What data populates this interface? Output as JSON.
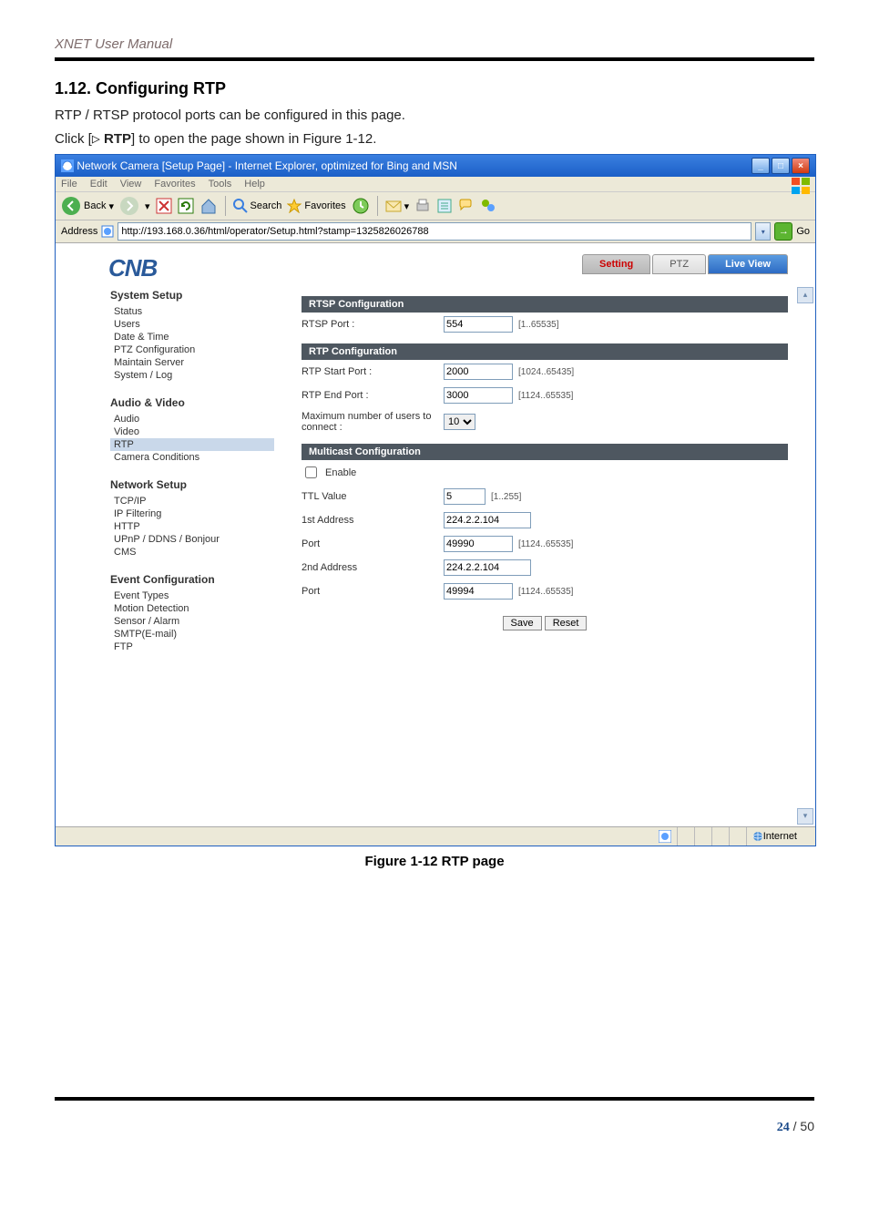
{
  "doc": {
    "manual_title": "XNET User Manual",
    "section_number_title": "1.12. Configuring RTP",
    "intro_1": "RTP / RTSP protocol ports can be configured in this page.",
    "intro_2a": "Click [",
    "intro_2_tri": "▷",
    "intro_2b": " RTP",
    "intro_2c": "] to open the page shown in Figure 1-12.",
    "figure_caption": "Figure 1-12 RTP page",
    "page_current": "24",
    "page_sep": " / ",
    "page_total": "50"
  },
  "ie": {
    "title": "Network Camera [Setup Page] - Internet Explorer, optimized for Bing and MSN",
    "menu": [
      "File",
      "Edit",
      "View",
      "Favorites",
      "Tools",
      "Help"
    ],
    "back": "Back",
    "search": "Search",
    "favorites": "Favorites",
    "address_label": "Address",
    "url": "http://193.168.0.36/html/operator/Setup.html?stamp=1325826026788",
    "go": "Go",
    "status_zone": "Internet"
  },
  "cam": {
    "logo": "CNB",
    "tabs": {
      "setting": "Setting",
      "ptz": "PTZ",
      "live": "Live View"
    },
    "sidebar": {
      "system": {
        "title": "System Setup",
        "items": [
          "Status",
          "Users",
          "Date & Time",
          "PTZ Configuration",
          "Maintain Server",
          "System / Log"
        ]
      },
      "av": {
        "title": "Audio & Video",
        "items": [
          "Audio",
          "Video",
          "RTP",
          "Camera Conditions"
        ]
      },
      "network": {
        "title": "Network Setup",
        "items": [
          "TCP/IP",
          "IP Filtering",
          "HTTP",
          "UPnP / DDNS / Bonjour",
          "CMS"
        ]
      },
      "event": {
        "title": "Event Configuration",
        "items": [
          "Event Types",
          "Motion Detection",
          "Sensor / Alarm",
          "SMTP(E-mail)",
          "FTP"
        ]
      }
    },
    "rtsp": {
      "header": "RTSP Configuration",
      "port_label": "RTSP Port :",
      "port_value": "554",
      "port_hint": "[1..65535]"
    },
    "rtp": {
      "header": "RTP Configuration",
      "start_label": "RTP Start Port :",
      "start_value": "2000",
      "start_hint": "[1024..65435]",
      "end_label": "RTP End Port :",
      "end_value": "3000",
      "end_hint": "[1124..65535]",
      "maxusers_label": "Maximum number of users to connect :",
      "maxusers_value": "10"
    },
    "mc": {
      "header": "Multicast Configuration",
      "enable": "Enable",
      "ttl_label": "TTL Value",
      "ttl_value": "5",
      "ttl_hint": "[1..255]",
      "addr1_label": "1st Address",
      "addr1_value": "224.2.2.104",
      "port1_label": "Port",
      "port1_value": "49990",
      "port1_hint": "[1124..65535]",
      "addr2_label": "2nd Address",
      "addr2_value": "224.2.2.104",
      "port2_label": "Port",
      "port2_value": "49994",
      "port2_hint": "[1124..65535]"
    },
    "buttons": {
      "save": "Save",
      "reset": "Reset"
    }
  }
}
